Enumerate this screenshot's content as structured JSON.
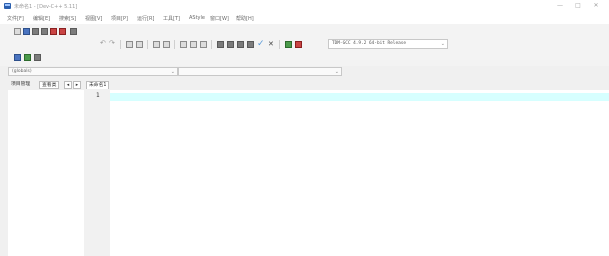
{
  "window": {
    "title": "未命名1 - [Dev-C++ 5.11]",
    "controls": {
      "minimize": "—",
      "maximize": "□",
      "close": "✕"
    }
  },
  "menu": [
    "文件[F]",
    "编辑[E]",
    "搜索[S]",
    "视图[V]",
    "项目[P]",
    "运行[R]",
    "工具[T]",
    "AStyle",
    "窗口[W]",
    "帮助[H]"
  ],
  "toolbar": {
    "row1_icons": [
      "new-file-icon",
      "open-icon",
      "save-icon",
      "save-all-icon",
      "close-file-icon",
      "close-all-icon",
      "print-icon"
    ],
    "row2_icons": [
      "undo-icon",
      "redo-icon",
      "find-icon",
      "replace-icon",
      "indent-icon",
      "unindent-icon",
      "goto-icon",
      "bookmark-icon",
      "toggle-icon",
      "compile-icon",
      "run-icon",
      "compile-run-icon",
      "rebuild-icon",
      "check-icon",
      "stop-icon",
      "debug-icon",
      "profile-icon"
    ],
    "row3_icons": [
      "new-project-icon",
      "add-file-icon",
      "remove-file-icon"
    ],
    "compiler": "TDM-GCC 4.9.2 64-bit Release"
  },
  "scope": {
    "left": "(globals)",
    "right": ""
  },
  "panel_tabs": {
    "project": "项目管理",
    "classes": "查看类",
    "nav_left": "◂",
    "nav_right": "▸"
  },
  "editor": {
    "tab_title": "未命名1",
    "line_number": "1",
    "current_line_color": "#d6ffff"
  }
}
